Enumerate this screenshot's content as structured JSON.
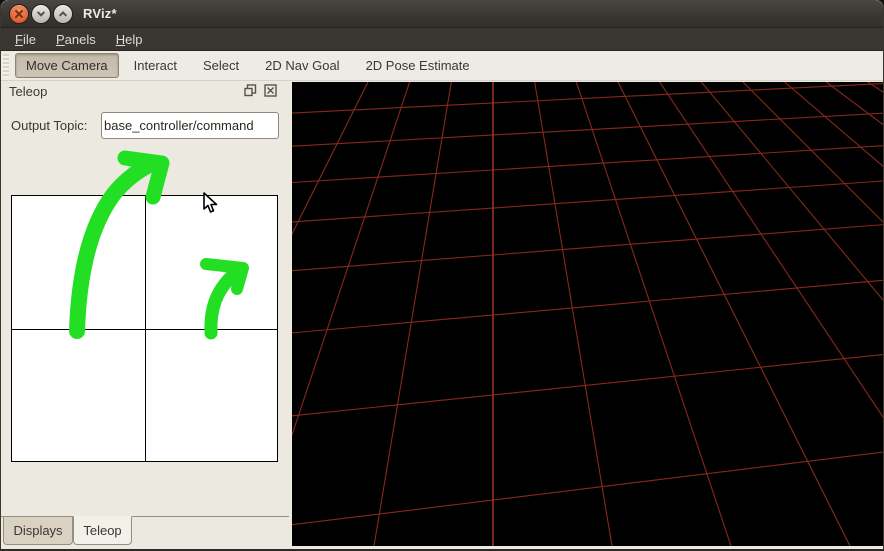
{
  "window": {
    "title": "RViz*"
  },
  "titlebar": {
    "buttons": [
      {
        "name": "close"
      },
      {
        "name": "minimize"
      },
      {
        "name": "maximize"
      }
    ]
  },
  "menu": {
    "items": [
      "File",
      "Panels",
      "Help"
    ]
  },
  "toolbar": {
    "tools": [
      "Move Camera",
      "Interact",
      "Select",
      "2D Nav Goal",
      "2D Pose Estimate"
    ],
    "active_tool": "Move Camera"
  },
  "teleop_panel": {
    "title": "Teleop",
    "output_topic_label": "Output Topic:",
    "output_topic_value": "base_controller/command"
  },
  "bottom_tabs": {
    "tabs": [
      "Displays",
      "Teleop"
    ],
    "active": "Teleop"
  },
  "viewport": {
    "background": "#000000",
    "grid_color": "#87291a",
    "grid_axis_color": "#a43522"
  },
  "annotations": {
    "arrow_color": "#23df23"
  }
}
